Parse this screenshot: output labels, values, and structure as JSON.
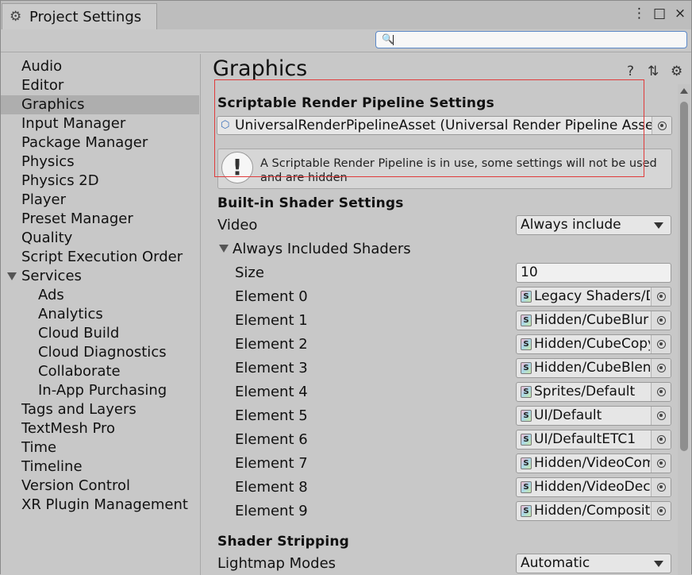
{
  "window": {
    "tab_title": "Project Settings",
    "menu_glyph": "⋮",
    "maximize_glyph": "□",
    "close_glyph": "×",
    "search_placeholder": ""
  },
  "sidebar": {
    "items": [
      {
        "label": "Audio"
      },
      {
        "label": "Editor"
      },
      {
        "label": "Graphics"
      },
      {
        "label": "Input Manager"
      },
      {
        "label": "Package Manager"
      },
      {
        "label": "Physics"
      },
      {
        "label": "Physics 2D"
      },
      {
        "label": "Player"
      },
      {
        "label": "Preset Manager"
      },
      {
        "label": "Quality"
      },
      {
        "label": "Script Execution Order"
      },
      {
        "label": "Services"
      },
      {
        "label": "Ads"
      },
      {
        "label": "Analytics"
      },
      {
        "label": "Cloud Build"
      },
      {
        "label": "Cloud Diagnostics"
      },
      {
        "label": "Collaborate"
      },
      {
        "label": "In-App Purchasing"
      },
      {
        "label": "Tags and Layers"
      },
      {
        "label": "TextMesh Pro"
      },
      {
        "label": "Time"
      },
      {
        "label": "Timeline"
      },
      {
        "label": "Version Control"
      },
      {
        "label": "XR Plugin Management"
      }
    ],
    "selected": "Graphics"
  },
  "main": {
    "title": "Graphics",
    "help_glyph": "?",
    "presets_glyph": "⇅",
    "settings_glyph": "⚙",
    "srp": {
      "header": "Scriptable Render Pipeline Settings",
      "asset": "UniversalRenderPipelineAsset (Universal Render Pipeline Asset)",
      "warning_glyph": "!",
      "warning": "A Scriptable Render Pipeline is in use, some settings will not be used and are hidden"
    },
    "builtin": {
      "header": "Built-in Shader Settings",
      "video_label": "Video",
      "video_value": "Always include",
      "always_included_label": "Always Included Shaders",
      "size_label": "Size",
      "size_value": "10",
      "shader_icon": "S",
      "elements": [
        {
          "label": "Element 0",
          "value": "Legacy Shaders/Diffuse"
        },
        {
          "label": "Element 1",
          "value": "Hidden/CubeBlur"
        },
        {
          "label": "Element 2",
          "value": "Hidden/CubeCopy"
        },
        {
          "label": "Element 3",
          "value": "Hidden/CubeBlend"
        },
        {
          "label": "Element 4",
          "value": "Sprites/Default"
        },
        {
          "label": "Element 5",
          "value": "UI/Default"
        },
        {
          "label": "Element 6",
          "value": "UI/DefaultETC1"
        },
        {
          "label": "Element 7",
          "value": "Hidden/VideoComposite"
        },
        {
          "label": "Element 8",
          "value": "Hidden/VideoDecode"
        },
        {
          "label": "Element 9",
          "value": "Hidden/Compositing"
        }
      ]
    },
    "stripping": {
      "header": "Shader Stripping",
      "lightmap_label": "Lightmap Modes",
      "lightmap_value": "Automatic"
    }
  }
}
